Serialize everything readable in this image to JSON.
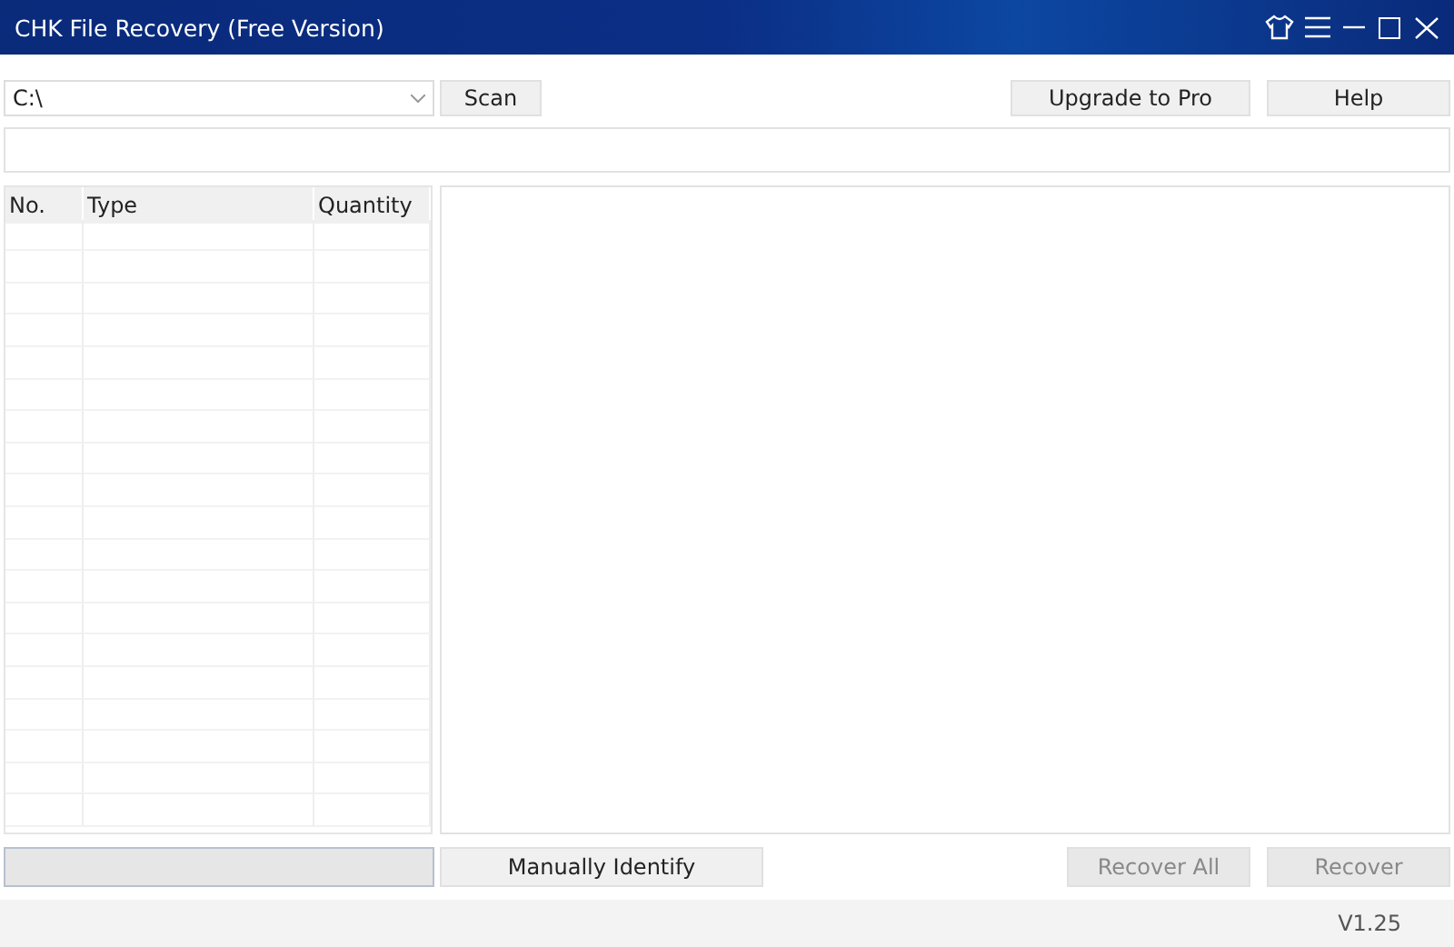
{
  "window": {
    "title": "CHK File Recovery (Free Version)"
  },
  "toolbar": {
    "drive": {
      "value": "C:\\"
    },
    "buttons": [
      {
        "label": "Scan",
        "disabled": false
      }
    ],
    "right_buttons": [
      {
        "label": "Upgrade to Pro",
        "disabled": false
      },
      {
        "label": "Help",
        "disabled": false
      }
    ]
  },
  "table": {
    "columns": [
      "No.",
      "Type",
      "Quantity"
    ]
  },
  "bottom": {
    "progress": {
      "level": 0
    },
    "buttons": [
      {
        "label": "Manually Identify",
        "disabled": false
      }
    ],
    "right_buttons": [
      {
        "label": "Recover All",
        "disabled": true
      },
      {
        "label": "Recover",
        "disabled": true
      }
    ]
  },
  "status_bar": {
    "version": "V1.25"
  }
}
